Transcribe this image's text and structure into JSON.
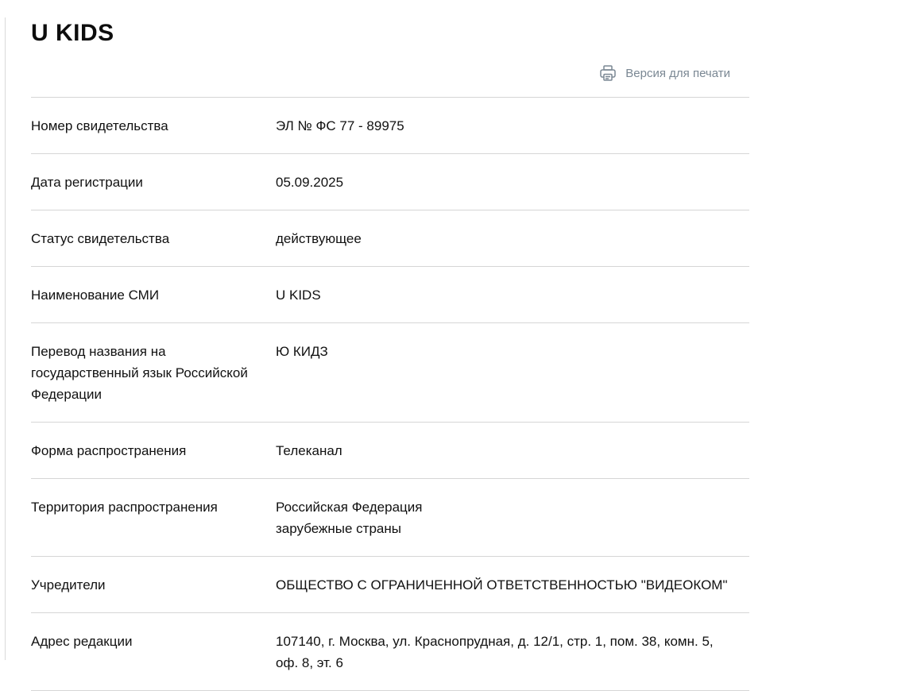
{
  "page": {
    "title": "U KIDS",
    "print_label": "Версия для печати"
  },
  "rows": [
    {
      "label": "Номер свидетельства",
      "value": [
        "ЭЛ № ФС 77 - 89975"
      ]
    },
    {
      "label": "Дата регистрации",
      "value": [
        "05.09.2025"
      ]
    },
    {
      "label": "Статус свидетельства",
      "value": [
        "действующее"
      ]
    },
    {
      "label": "Наименование СМИ",
      "value": [
        "U KIDS"
      ]
    },
    {
      "label": "Перевод названия на государственный язык Российской Федерации",
      "value": [
        "Ю КИДЗ"
      ]
    },
    {
      "label": "Форма распространения",
      "value": [
        "Телеканал"
      ]
    },
    {
      "label": "Территория распространения",
      "value": [
        "Российская Федерация",
        "зарубежные страны"
      ]
    },
    {
      "label": "Учредители",
      "value": [
        "ОБЩЕСТВО С ОГРАНИЧЕННОЙ ОТВЕТСТВЕННОСТЬЮ \"ВИДЕОКОМ\""
      ]
    },
    {
      "label": "Адрес редакции",
      "value": [
        "107140, г. Москва, ул. Краснопрудная, д. 12/1, стр. 1, пом. 38, комн. 5, оф. 8, эт. 6"
      ]
    }
  ],
  "icons": {
    "print": "printer-icon"
  },
  "colors": {
    "link": "#7a8793",
    "divider": "#d6d6d6",
    "text": "#111111"
  }
}
